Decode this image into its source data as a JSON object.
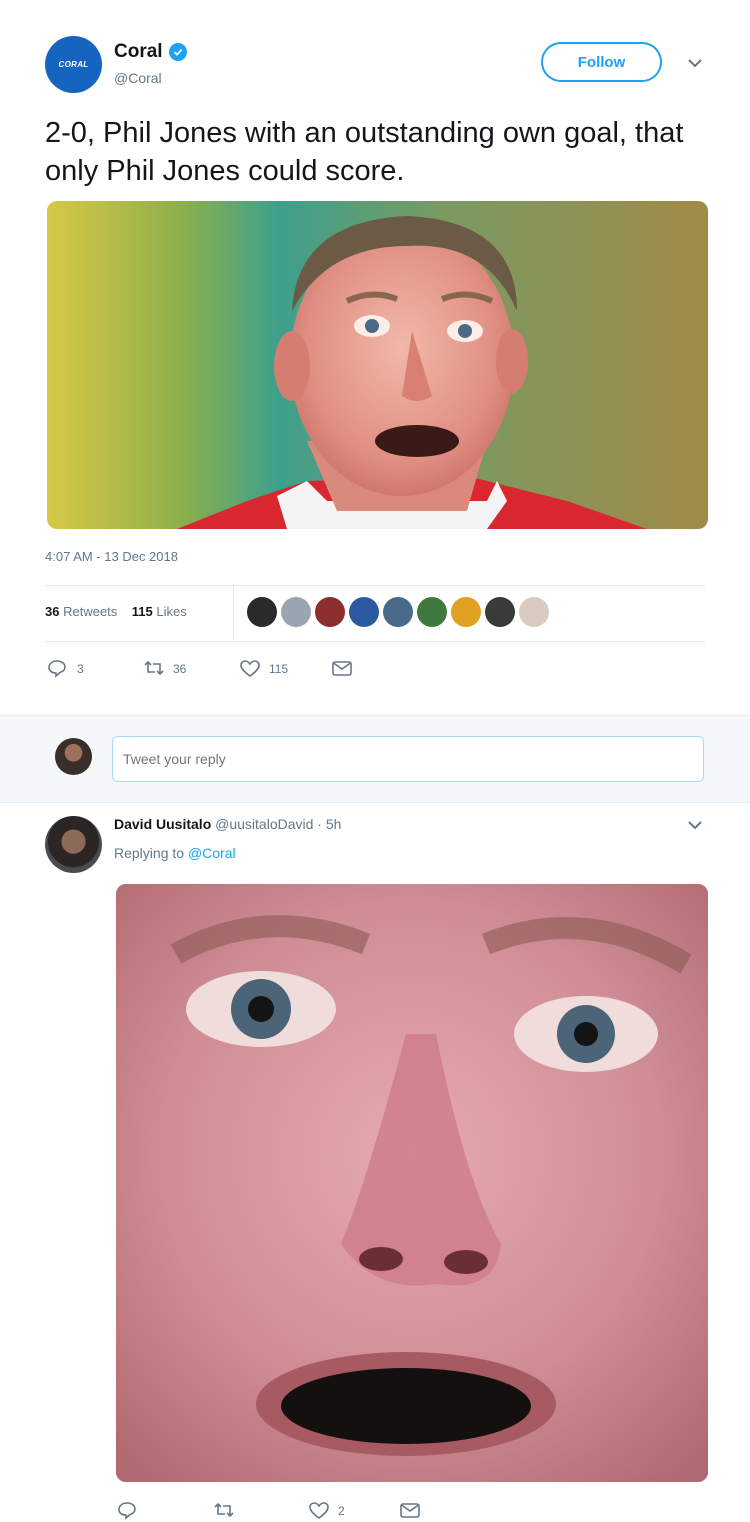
{
  "main_tweet": {
    "avatar_text": "CORAL",
    "display_name": "Coral",
    "handle": "@Coral",
    "follow_label": "Follow",
    "text": "2-0, Phil Jones with an outstanding own goal, that only Phil Jones could score.",
    "timestamp": "4:07 AM - 13 Dec 2018",
    "retweets_count": "36",
    "retweets_label": "Retweets",
    "likes_count": "115",
    "likes_label": "Likes",
    "likers": [
      "#2a2a2a",
      "#9aa5b1",
      "#8b2e2e",
      "#2c5aa0",
      "#4a6a8a",
      "#3e7a3e",
      "#e0a020",
      "#3a3a3a",
      "#d8ccc0"
    ],
    "actions": {
      "reply_count": "3",
      "retweet_count": "36",
      "like_count": "115"
    }
  },
  "reply_box": {
    "placeholder": "Tweet your reply"
  },
  "reply_tweet": {
    "display_name": "David Uusitalo",
    "handle": "@uusitaloDavid",
    "separator": "·",
    "time": "5h",
    "replying_prefix": "Replying to",
    "replying_to": "@Coral",
    "actions": {
      "reply_count": "",
      "retweet_count": "",
      "like_count": "2"
    }
  },
  "colors": {
    "accent": "#1da1f2",
    "muted": "#657786",
    "text": "#14171a"
  }
}
